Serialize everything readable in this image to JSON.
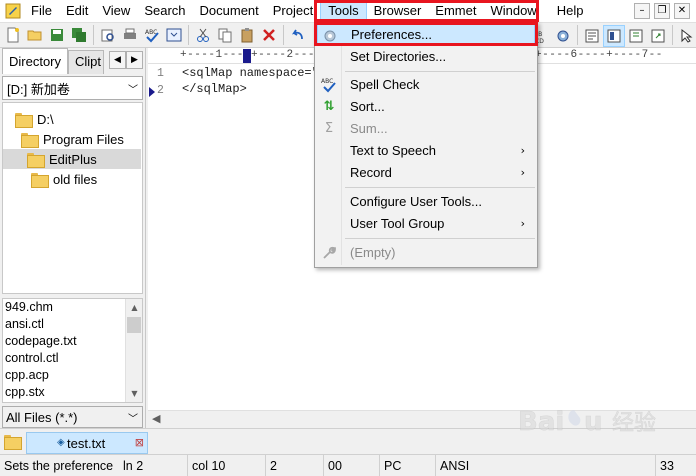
{
  "menubar": {
    "items": [
      "File",
      "Edit",
      "View",
      "Search",
      "Document",
      "Project",
      "Tools",
      "Browser",
      "Emmet",
      "Window",
      "Help"
    ],
    "active_index": 6
  },
  "toolbar": {
    "icons": [
      "new-document-icon",
      "open-folder-icon",
      "save-icon",
      "save-all-icon",
      "print-preview-icon",
      "print-icon",
      "spell-check-icon",
      "browser-preview-icon",
      "cut-icon",
      "copy-icon",
      "paste-icon",
      "delete-icon",
      "undo-icon"
    ],
    "right_icons": [
      "spell-check-icon",
      "preferences-icon",
      "word-wrap-icon",
      "ruler-icon",
      "line-number-icon",
      "fullscreen-icon",
      "help-icon"
    ]
  },
  "left_panel": {
    "tabs": [
      "Directory",
      "Clipt"
    ],
    "drive": "[D:] 新加卷",
    "tree": [
      {
        "label": "D:\\",
        "indent": 0
      },
      {
        "label": "Program Files",
        "indent": 1
      },
      {
        "label": "EditPlus",
        "indent": 2,
        "selected": true
      },
      {
        "label": "old files",
        "indent": 3
      }
    ],
    "files": [
      "949.chm",
      "ansi.ctl",
      "codepage.txt",
      "control.ctl",
      "cpp.acp",
      "cpp.stx"
    ],
    "filter": "All Files (*.*)"
  },
  "editor": {
    "ruler": "+----1----+----2----+----3----+----4----+----5----+----6----+----7--",
    "ruler_6": "6",
    "ruler_7": "7",
    "lines": [
      {
        "number": "1",
        "text": "<sqlMap namespace=\""
      },
      {
        "number": "2",
        "text": "</sqlMap>"
      }
    ]
  },
  "doc_tabs": {
    "active": "test.txt"
  },
  "statusbar": {
    "message": "Sets the preference",
    "line": "ln 2",
    "col": "col 10",
    "c3": "2",
    "c4": "00",
    "c5": "PC",
    "c6": "ANSI",
    "c7": "33"
  },
  "tools_menu": {
    "items": [
      {
        "label": "Preferences...",
        "icon": "preferences-gear-icon",
        "highlighted": true
      },
      {
        "label": "Set Directories...",
        "icon": ""
      },
      {
        "label": "Spell Check",
        "icon": "spell-check-icon"
      },
      {
        "label": "Sort...",
        "icon": "sort-icon"
      },
      {
        "label": "Sum...",
        "icon": "sum-icon",
        "disabled": true
      },
      {
        "label": "Text to Speech",
        "icon": "",
        "submenu": true
      },
      {
        "label": "Record",
        "icon": "",
        "submenu": true
      },
      {
        "label": "Configure User Tools...",
        "icon": ""
      },
      {
        "label": "User Tool Group",
        "icon": "",
        "submenu": true
      },
      {
        "label": "(Empty)",
        "icon": "wrench-icon",
        "disabled": true
      }
    ]
  },
  "colors": {
    "highlight_red": "#e8151f",
    "menu_hover": "#cce8ff",
    "folder": "#f5cf63"
  }
}
